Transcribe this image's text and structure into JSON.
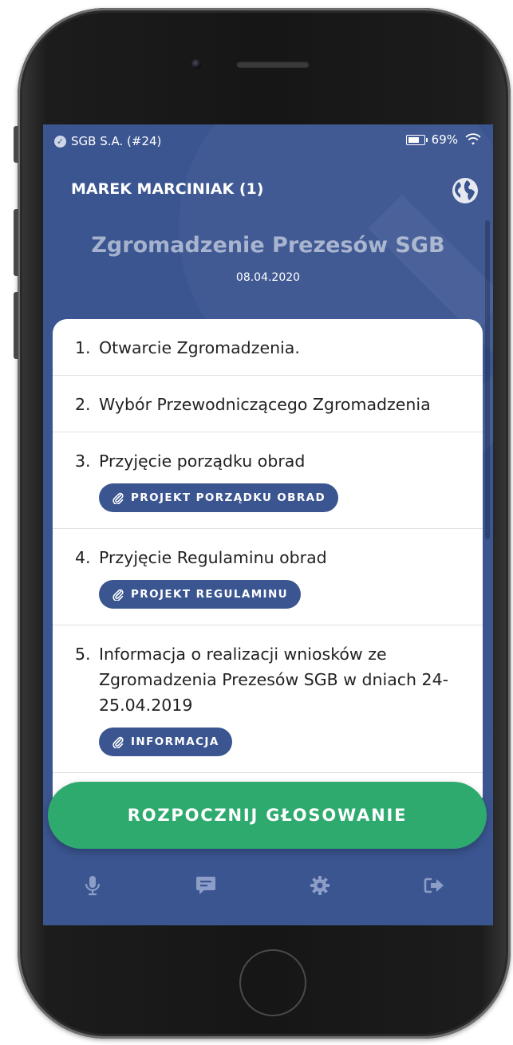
{
  "status": {
    "operator": "SGB S.A. (#24)",
    "battery": "69%"
  },
  "header": {
    "user": "MAREK MARCINIAK (1)",
    "title": "Zgromadzenie Prezesów SGB",
    "date": "08.04.2020"
  },
  "agenda": [
    {
      "num": "1.",
      "text": "Otwarcie Zgromadzenia."
    },
    {
      "num": "2.",
      "text": "Wybór Przewodniczącego Zgromadzenia"
    },
    {
      "num": "3.",
      "text": "Przyjęcie porządku obrad",
      "doc": "PROJEKT PORZĄDKU OBRAD"
    },
    {
      "num": "4.",
      "text": "Przyjęcie Regulaminu obrad",
      "doc": "PROJEKT REGULAMINU"
    },
    {
      "num": "5.",
      "text": "Informacja o realizacji wniosków ze Zgromadzenia Prezesów SGB w dniach 24-25.04.2019",
      "doc": "INFORMACJA"
    }
  ],
  "actions": {
    "vote": "ROZPOCZNIJ GŁOSOWANIE"
  },
  "tabbar": [
    "microphone-icon",
    "chat-icon",
    "gear-icon",
    "logout-icon"
  ],
  "colors": {
    "brand": "#3b5591",
    "accent": "#2eaa6e",
    "icon_inactive": "#8c9dc7"
  }
}
